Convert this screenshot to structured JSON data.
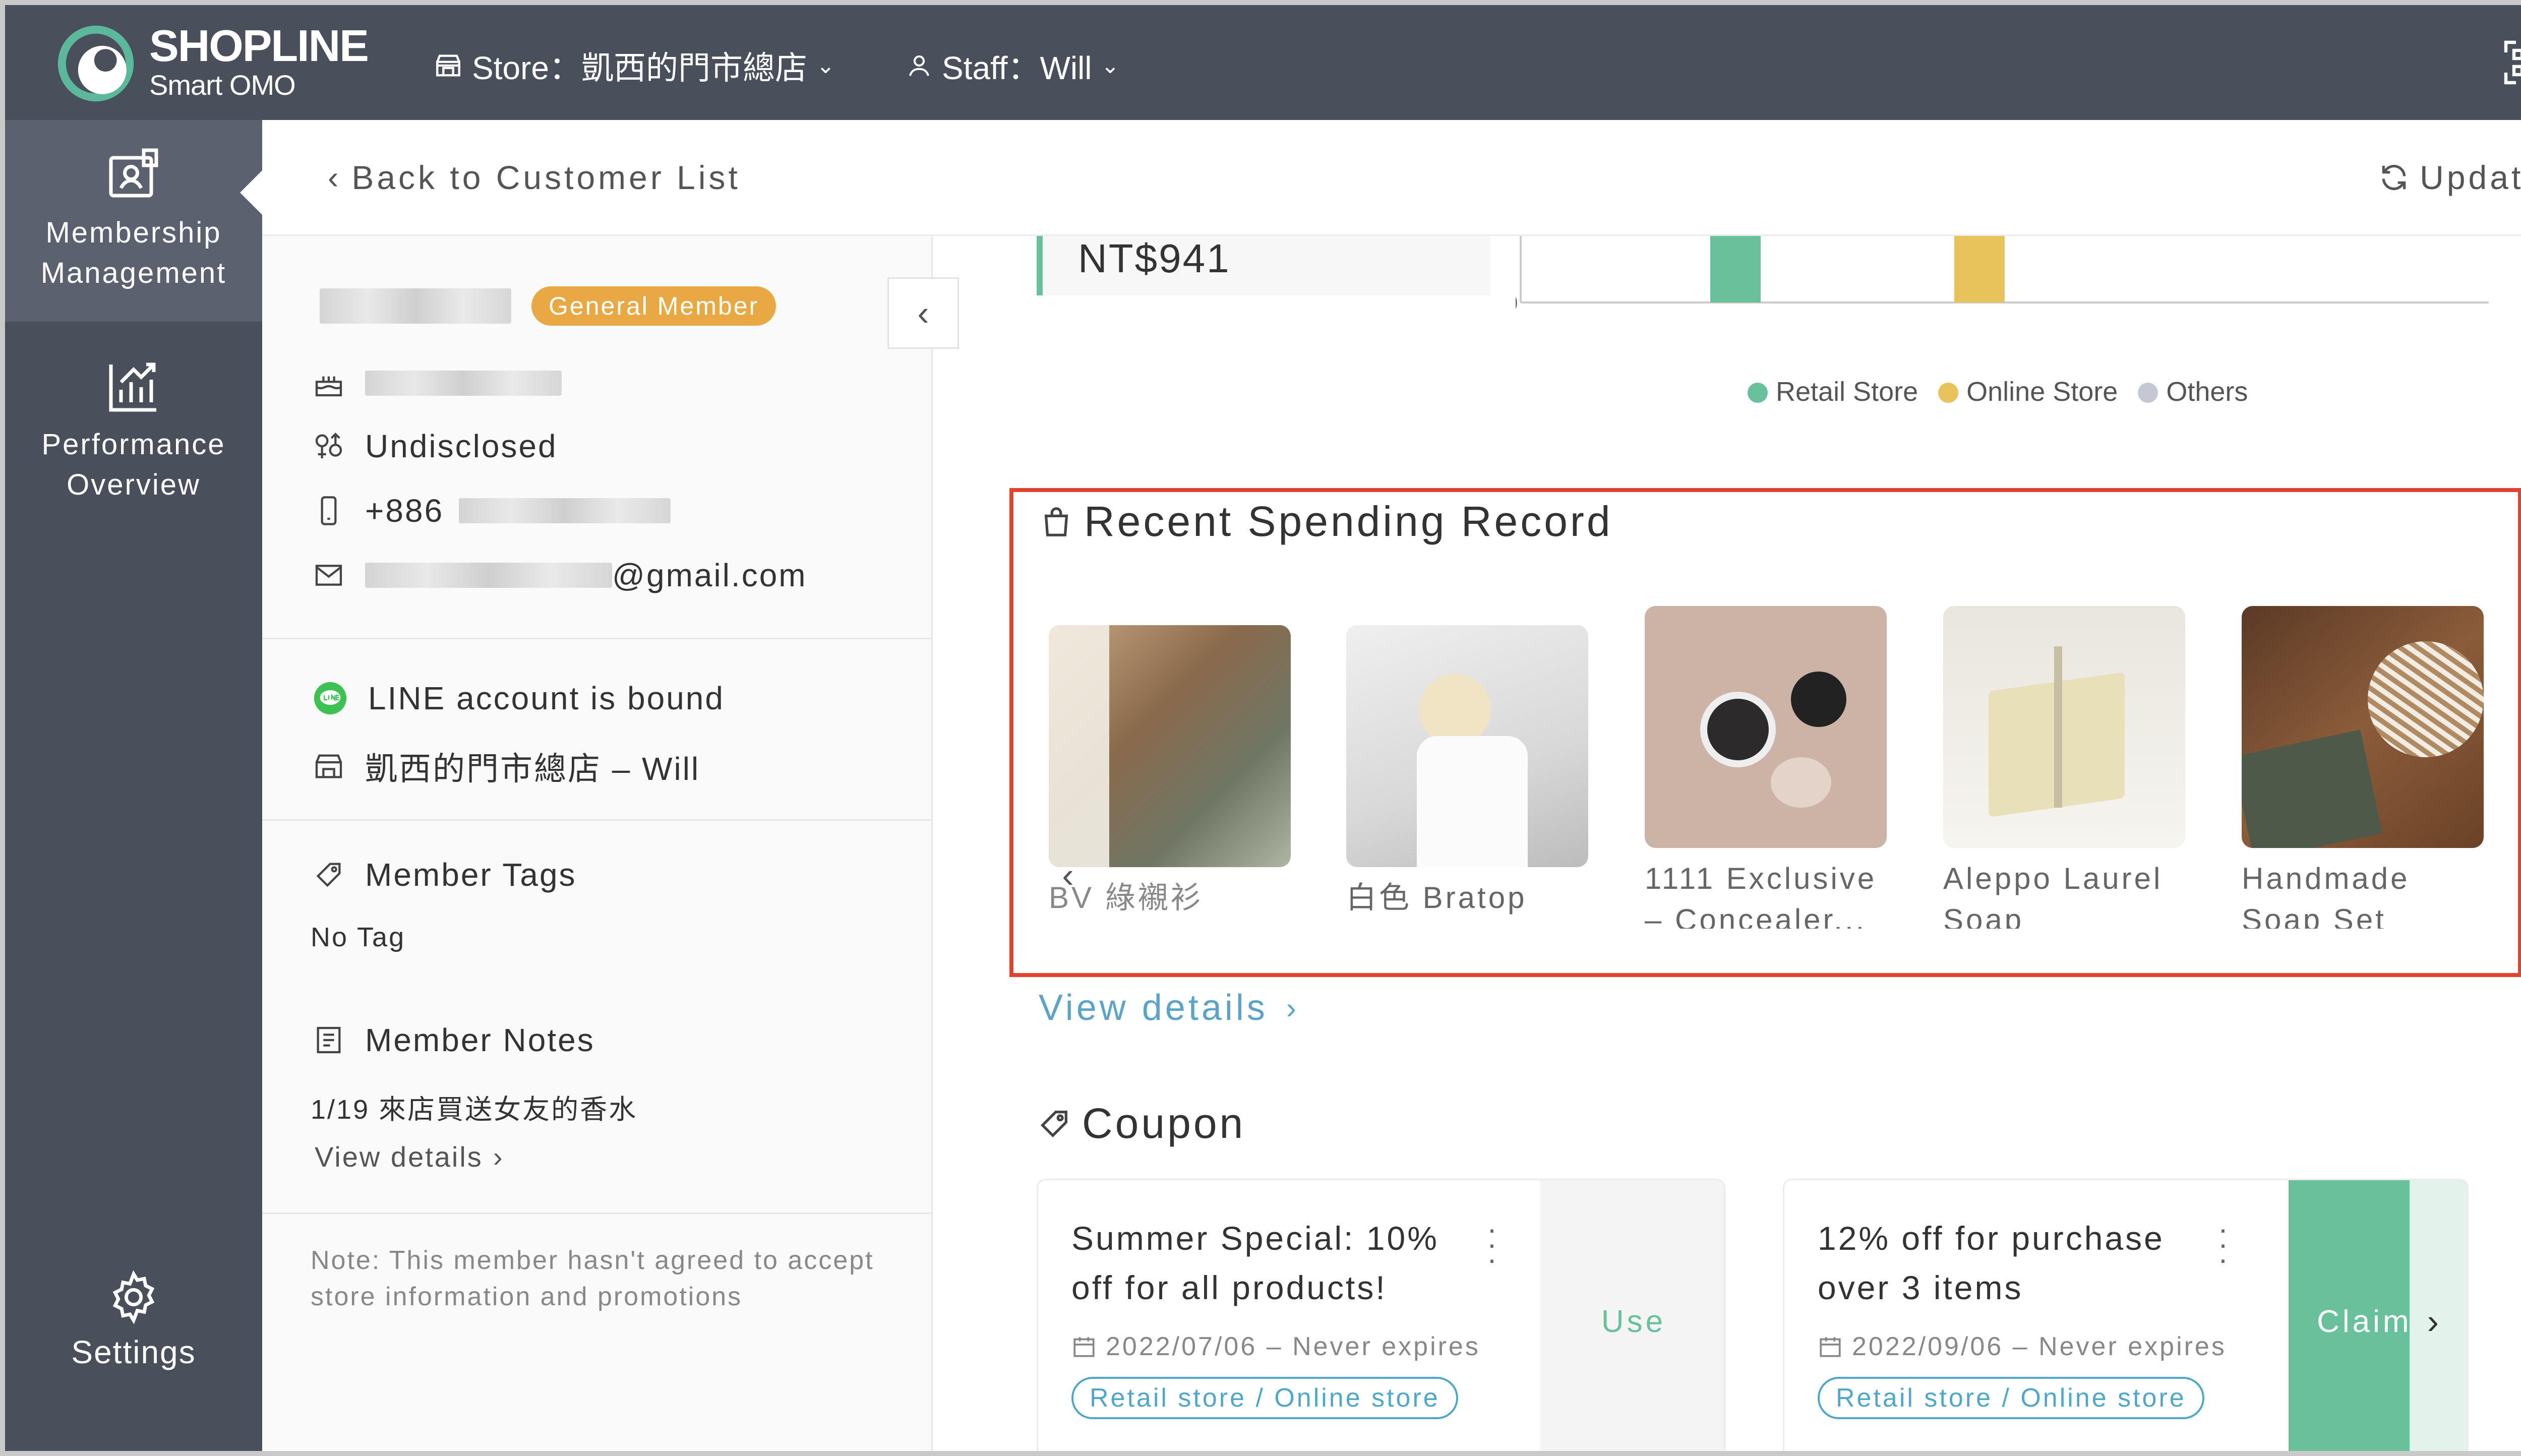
{
  "topbar": {
    "brand": "SHOPLINE",
    "brand_sub": "Smart OMO",
    "store_label": "Store：凱西的門市總店",
    "staff_label": "Staff：Will"
  },
  "nav": {
    "items": [
      {
        "label_line1": "Membership",
        "label_line2": "Management",
        "icon": "member-card-icon",
        "active": true
      },
      {
        "label_line1": "Performance",
        "label_line2": "Overview",
        "icon": "chart-up-icon",
        "active": false
      }
    ],
    "settings": "Settings"
  },
  "header": {
    "back": "Back to Customer List",
    "update": "Update"
  },
  "profile": {
    "badge": "General Member",
    "gender": "Undisclosed",
    "phone_prefix": "+886",
    "email_suffix": "@gmail.com",
    "line_status": "LINE account is bound",
    "store_staff": "凱西的門市總店 – Will",
    "tags_title": "Member Tags",
    "tags_value": "No Tag",
    "notes_title": "Member Notes",
    "notes_value": "1/19 來店買送女友的香水",
    "notes_link": "View details",
    "disclaimer": "Note: This member hasn't agreed to accept store information and promotions"
  },
  "summary": {
    "amount": "NT$941",
    "axis_zero": "0",
    "legend": [
      {
        "label": "Retail Store",
        "color": "#68c19b"
      },
      {
        "label": "Online Store",
        "color": "#e8c25a"
      },
      {
        "label": "Others",
        "color": "#c5c8d3"
      }
    ]
  },
  "recent": {
    "title": "Recent Spending Record",
    "products": [
      {
        "name": "BV 綠襯衫"
      },
      {
        "name": "白色 Bratop"
      },
      {
        "name": "1111 Exclusive – Concealer..."
      },
      {
        "name": "Aleppo Laurel Soap"
      },
      {
        "name": "Handmade Soap Set"
      }
    ],
    "view_details": "View details"
  },
  "coupons": {
    "title": "Coupon",
    "items": [
      {
        "title": "Summer Special: 10% off for all products!",
        "date": "2022/07/06 – Never expires",
        "tag": "Retail store / Online store",
        "action": "Use"
      },
      {
        "title": "12% off for purchase over 3 items",
        "date": "2022/09/06 – Never expires",
        "tag": "Retail store / Online store",
        "action": "Claim"
      }
    ]
  }
}
